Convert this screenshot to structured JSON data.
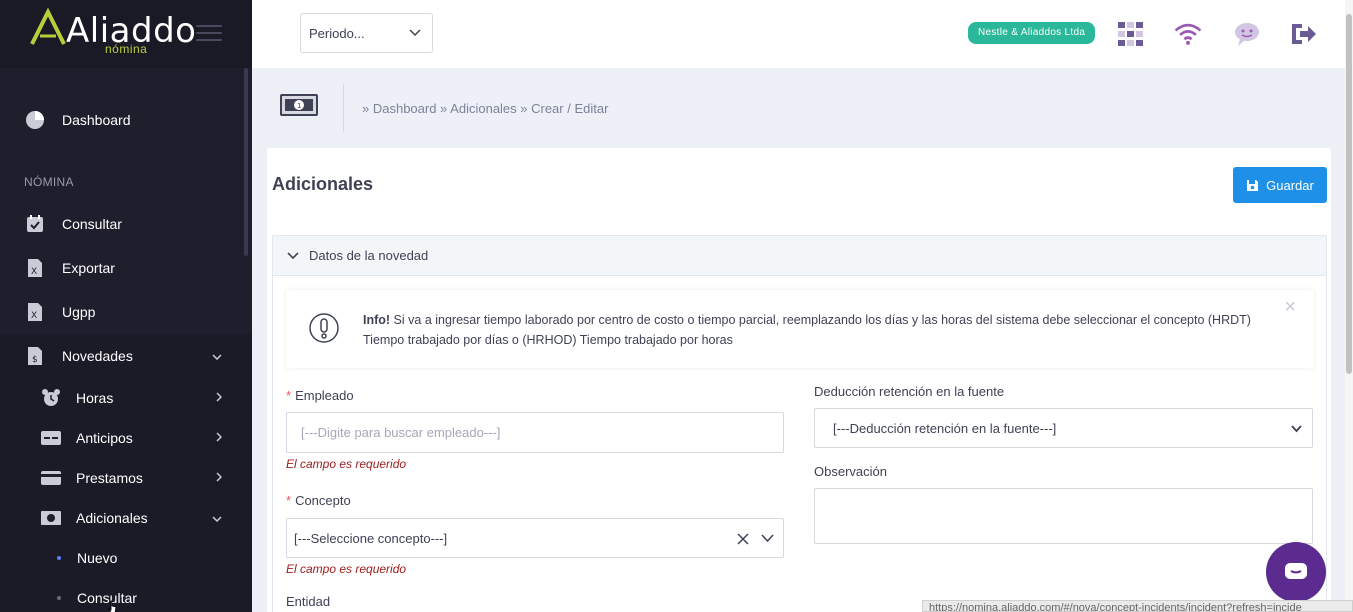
{
  "brand": {
    "name": "Aliaddo",
    "sub": "nómina"
  },
  "topbar": {
    "period_placeholder": "Periodo...",
    "company": "Nestle & Aliaddos Ltda"
  },
  "sidebar": {
    "dashboard": "Dashboard",
    "section_title": "NÓMINA",
    "items": [
      {
        "label": "Consultar",
        "icon": "calendar-check-icon"
      },
      {
        "label": "Exportar",
        "icon": "excel-file-icon"
      },
      {
        "label": "Ugpp",
        "icon": "excel-file-icon"
      },
      {
        "label": "Novedades",
        "icon": "dollar-file-icon"
      }
    ],
    "sub_items": [
      {
        "label": "Horas",
        "icon": "alarm-clock-icon"
      },
      {
        "label": "Anticipos",
        "icon": "card-icon"
      },
      {
        "label": "Prestamos",
        "icon": "credit-card-icon"
      },
      {
        "label": "Adicionales",
        "icon": "money-icon"
      }
    ],
    "leaf_items": [
      {
        "label": "Nuevo"
      },
      {
        "label": "Consultar"
      }
    ]
  },
  "breadcrumb": "» Dashboard » Adicionales » Crear / Editar",
  "card": {
    "title": "Adicionales",
    "save_label": "Guardar",
    "section_title": "Datos de la novedad",
    "alert_strong": "Info!",
    "alert_text": " Si va a ingresar tiempo laborado por centro de costo o tiempo parcial, reemplazando los días y las horas del sistema debe seleccionar el concepto (HRDT) Tiempo trabajado por días o (HRHOD) Tiempo trabajado por horas",
    "fields": {
      "empleado_label": "Empleado",
      "empleado_placeholder": "[---Digite para buscar empleado---]",
      "required_error": "El campo es requerido",
      "concepto_label": "Concepto",
      "concepto_value": "[---Seleccione concepto---]",
      "entidad_label": "Entidad",
      "deduccion_label": "Deducción retención en la fuente",
      "deduccion_value": "[---Deducción retención en la fuente---]",
      "observacion_label": "Observación"
    }
  },
  "status_url": "https://nomina.aliaddo.com/#/nova/concept-incidents/incident?refresh=incide",
  "colors": {
    "sidebar": "#1e1e2d",
    "primary": "#1e90e8",
    "badge": "#2bb89a",
    "chat": "#5b2b8f"
  }
}
